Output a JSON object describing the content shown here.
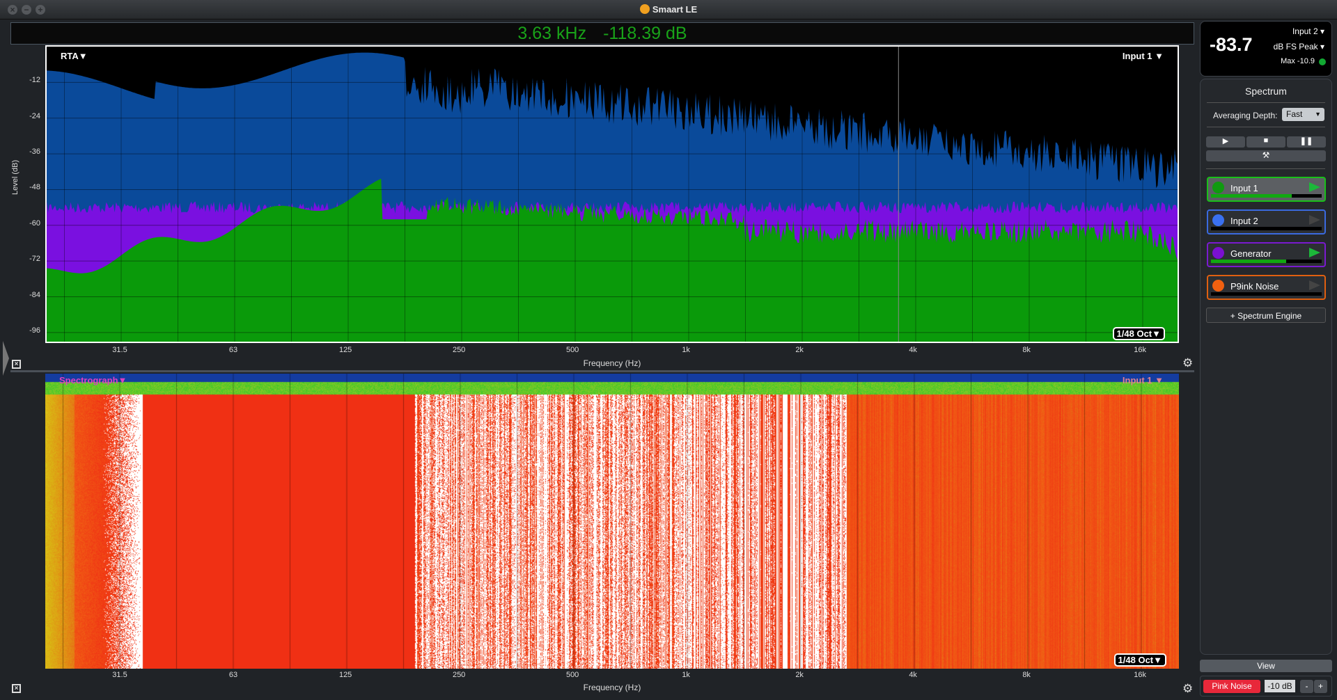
{
  "window": {
    "title": "Smaart LE"
  },
  "readout": {
    "frequency": "3.63 kHz",
    "level": "-118.39 dB"
  },
  "rta": {
    "label": "RTA▼",
    "input_label": "Input 1 ▼",
    "resolution": "1/48 Oct▼",
    "y_title": "Level (dB)",
    "y_ticks": [
      "-12",
      "-24",
      "-36",
      "-48",
      "-60",
      "-72",
      "-84",
      "-96"
    ],
    "y_range": [
      0,
      -100
    ],
    "x_title": "Frequency (Hz)",
    "x_ticks": [
      "31.5",
      "63",
      "125",
      "250",
      "500",
      "1k",
      "2k",
      "4k",
      "8k",
      "16k"
    ],
    "cursor_freq_hz": 3630,
    "colors": {
      "input2": "#0a4a9a",
      "generator": "#7a10e0",
      "input1": "#0a9a0a"
    }
  },
  "spectrograph": {
    "label": "Spectrograph▼",
    "input_label": "Input 1 ▼",
    "resolution": "1/48 Oct▼",
    "x_title": "Frequency (Hz)",
    "x_ticks": [
      "31.5",
      "63",
      "125",
      "250",
      "500",
      "1k",
      "2k",
      "4k",
      "8k",
      "16k"
    ]
  },
  "meter": {
    "value": "-83.7",
    "source": "Input 2",
    "mode": "dB FS Peak",
    "max": "Max -10.9",
    "status_color": "#12a832"
  },
  "spectrum": {
    "title": "Spectrum",
    "averaging_label": "Averaging Depth:",
    "averaging_value": "Fast",
    "engines": [
      {
        "name": "Input 1",
        "color": "#109a10",
        "border": "#19c019",
        "level": 0.73,
        "active": true
      },
      {
        "name": "Input 2",
        "color": "#3a70f0",
        "border": "#3a6ae0",
        "level": 0,
        "active": false
      },
      {
        "name": "Generator",
        "color": "#7a10d0",
        "border": "#7a1ad0",
        "level": 0.68,
        "active": true
      },
      {
        "name": "P9ink Noise",
        "color": "#f06010",
        "border": "#e06010",
        "level": 0,
        "active": false
      }
    ],
    "add_engine": "+ Spectrum Engine"
  },
  "view_button": "View",
  "generator": {
    "button": "Pink Noise",
    "level": "-10 dB",
    "minus": "-",
    "plus": "+"
  }
}
